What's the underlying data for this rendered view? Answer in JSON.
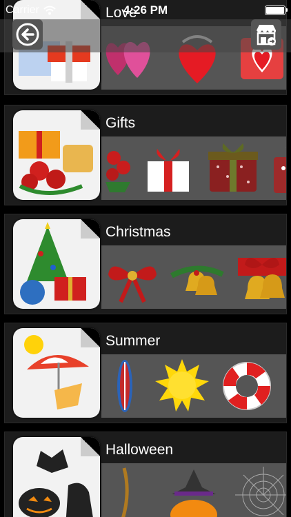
{
  "status": {
    "carrier": "Carrier",
    "time": "4:26 PM",
    "battery_level": 1.0
  },
  "nav": {
    "back_icon": "back-arrow-icon",
    "store_icon": "store-icon"
  },
  "categories": [
    {
      "title": "Love",
      "icon": "love-icon",
      "thumbs": [
        "pink-hearts",
        "red-heart-ribbon",
        "heart-card"
      ]
    },
    {
      "title": "Gifts",
      "icon": "gifts-icon",
      "thumbs": [
        "rose-bouquet",
        "gift-box-white",
        "gift-box-green",
        "gift-box-polka"
      ]
    },
    {
      "title": "Christmas",
      "icon": "christmas-icon",
      "thumbs": [
        "red-bow",
        "christmas-bells",
        "gift-bells"
      ]
    },
    {
      "title": "Summer",
      "icon": "summer-icon",
      "thumbs": [
        "surfboard",
        "sun",
        "lifebuoy"
      ]
    },
    {
      "title": "Halloween",
      "icon": "halloween-icon",
      "thumbs": [
        "broom",
        "jack-o-lantern-witch-hat",
        "spider-web"
      ]
    }
  ]
}
